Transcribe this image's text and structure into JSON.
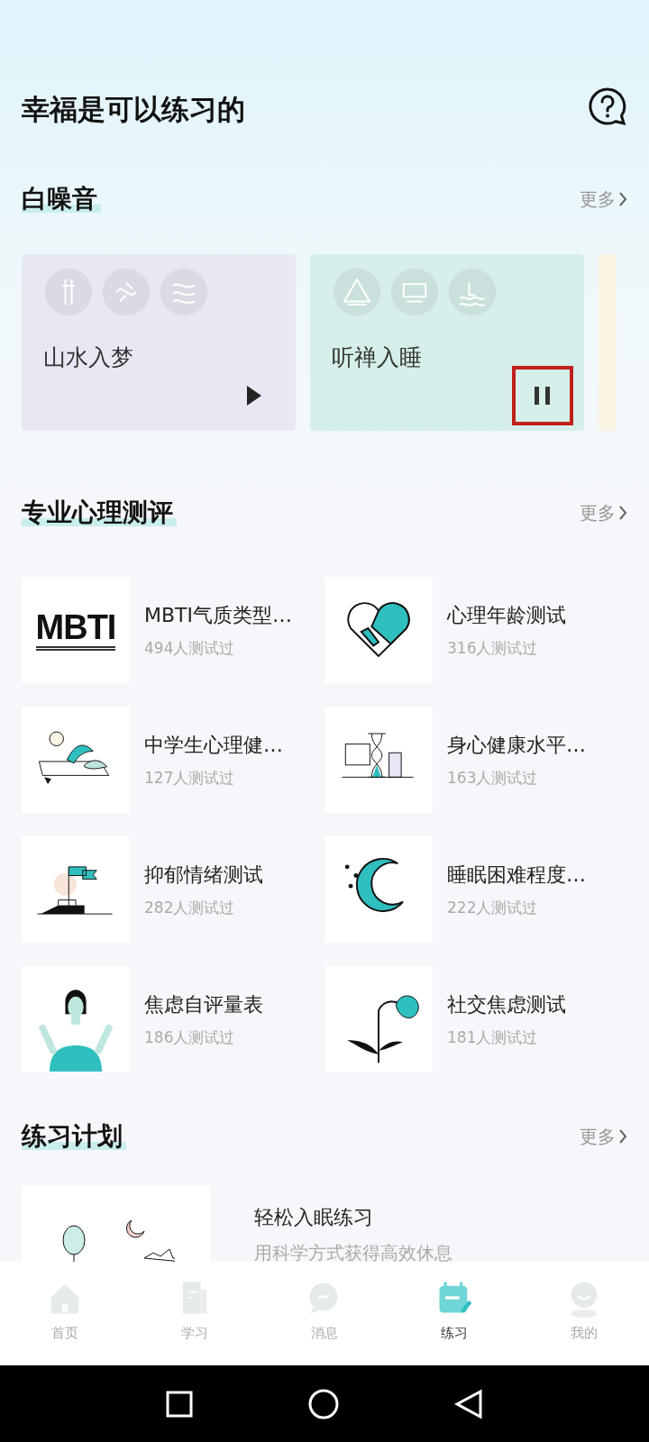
{
  "header": {
    "title": "幸福是可以练习的"
  },
  "white_noise": {
    "title": "白噪音",
    "more": "更多",
    "cards": [
      {
        "title": "山水入梦",
        "playing": false,
        "highlighted": false,
        "color": "#e8e8f4"
      },
      {
        "title": "听禅入睡",
        "playing": true,
        "highlighted": true,
        "color": "#d6efea"
      }
    ]
  },
  "assessments": {
    "title": "专业心理测评",
    "more": "更多",
    "items": [
      {
        "title": "MBTI气质类型…",
        "count": "494人测试过",
        "logo_text": "MBTI"
      },
      {
        "title": "心理年龄测试",
        "count": "316人测试过"
      },
      {
        "title": "中学生心理健…",
        "count": "127人测试过"
      },
      {
        "title": "身心健康水平…",
        "count": "163人测试过"
      },
      {
        "title": "抑郁情绪测试",
        "count": "282人测试过"
      },
      {
        "title": "睡眠困难程度…",
        "count": "222人测试过"
      },
      {
        "title": "焦虑自评量表",
        "count": "186人测试过"
      },
      {
        "title": "社交焦虑测试",
        "count": "181人测试过"
      }
    ]
  },
  "plan": {
    "title": "练习计划",
    "more": "更多",
    "items": [
      {
        "title": "轻松入眠练习",
        "subtitle": "用科学方式获得高效休息"
      }
    ]
  },
  "tab_bar": [
    {
      "label": "首页",
      "selected": false
    },
    {
      "label": "学习",
      "selected": false
    },
    {
      "label": "消息",
      "selected": false
    },
    {
      "label": "练习",
      "selected": true
    },
    {
      "label": "我的",
      "selected": false
    }
  ]
}
